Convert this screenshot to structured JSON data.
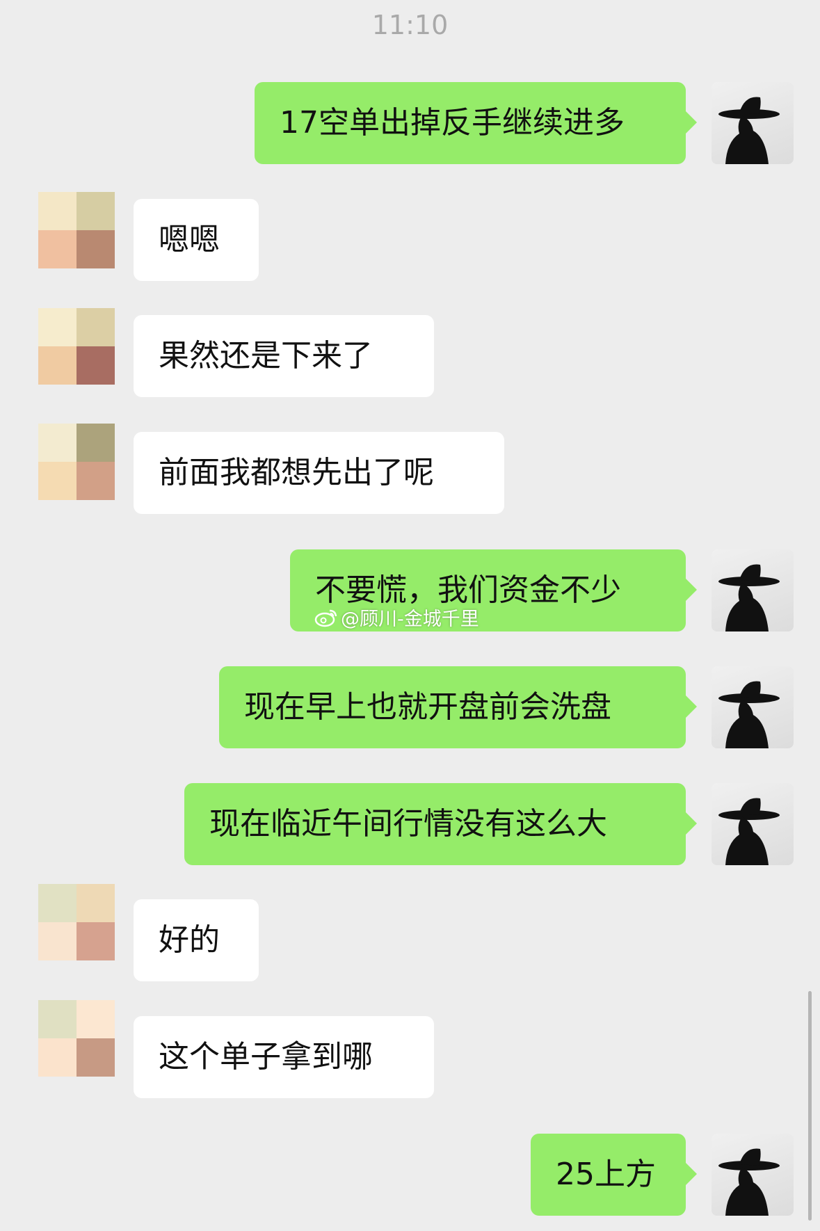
{
  "timestamp": "11:10",
  "watermark": "@顾川-金城千里",
  "messages": [
    {
      "side": "me",
      "text": "17空单出掉反手继续进多"
    },
    {
      "side": "them",
      "text": "嗯嗯",
      "avatar": [
        "#f4e7c6",
        "#d6cda3",
        "#f0c0a0",
        "#b98971"
      ]
    },
    {
      "side": "them",
      "text": "果然还是下来了",
      "avatar": [
        "#f6eccd",
        "#dccfa5",
        "#f0cba2",
        "#a86d62"
      ]
    },
    {
      "side": "them",
      "text": "前面我都想先出了呢",
      "avatar": [
        "#f3ebd0",
        "#aca37c",
        "#f5dbb2",
        "#d2a087"
      ]
    },
    {
      "side": "me",
      "text": "不要慌，我们资金不少"
    },
    {
      "side": "me",
      "text": "现在早上也就开盘前会洗盘"
    },
    {
      "side": "me",
      "text": "现在临近午间行情没有这么大"
    },
    {
      "side": "them",
      "text": "好的",
      "avatar": [
        "#e1e1c3",
        "#eed9b5",
        "#f9e4cf",
        "#d6a28f"
      ]
    },
    {
      "side": "them",
      "text": "这个单子拿到哪",
      "avatar": [
        "#e0e0c2",
        "#fce7d1",
        "#fbe3cc",
        "#c79a84"
      ]
    },
    {
      "side": "me",
      "text": "25上方"
    }
  ],
  "colors": {
    "background": "#ededed",
    "my_bubble": "#95ec69",
    "their_bubble": "#ffffff",
    "timestamp": "#a9a9a9"
  }
}
